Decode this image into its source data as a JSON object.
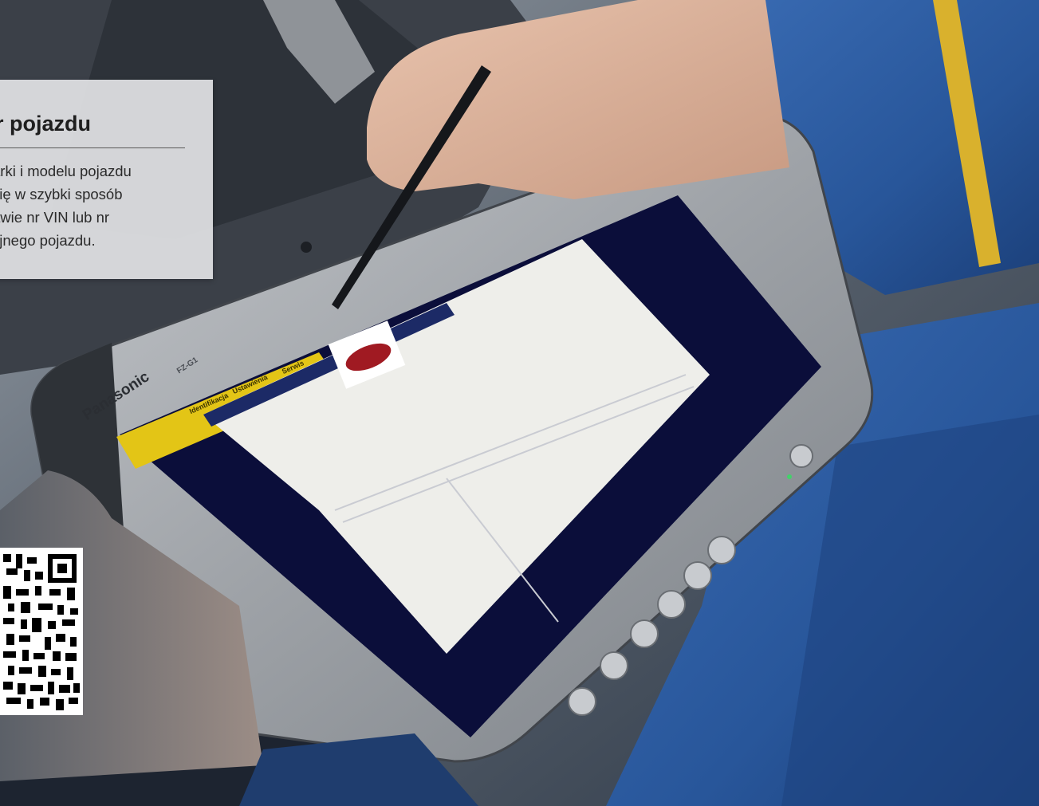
{
  "info_panel": {
    "title": "r pojazdu",
    "lines": [
      "arki i modelu pojazdu",
      "się w szybki sposób",
      "awie nr VIN lub nr",
      "yjnego pojazdu."
    ]
  },
  "tablet": {
    "brand": "Panasonic",
    "model": "FZ-G1"
  },
  "screen": {
    "tabs": [
      "Identifikacja",
      "Ustawienia",
      "Serwis"
    ]
  },
  "icons": {
    "qr": "qr-code-icon",
    "power": "power-icon"
  },
  "colors": {
    "panel_bg": "#e1e2e4",
    "screen_bg": "#0b0e3a",
    "tablet_frame": "#9a9ea3",
    "yellow_bar": "#e3c516",
    "uniform_blue": "#2d5fa6"
  }
}
